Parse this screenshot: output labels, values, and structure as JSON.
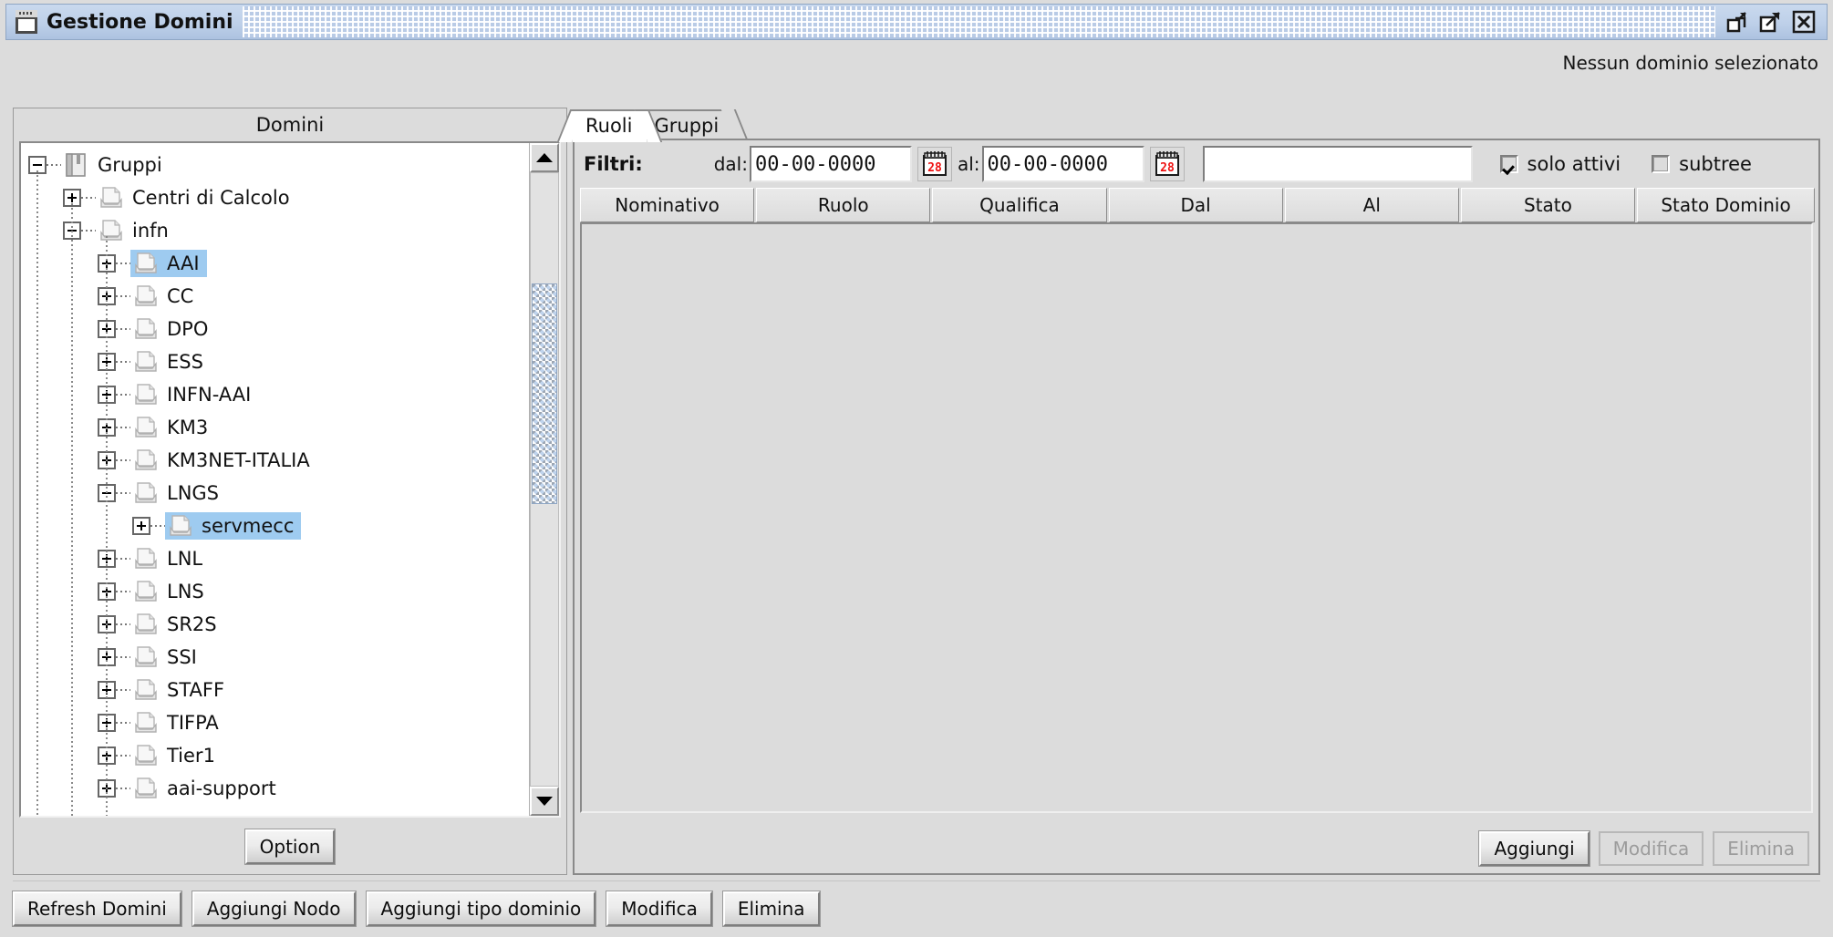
{
  "window": {
    "title": "Gestione Domini",
    "icon": "window-document-icon",
    "controls": [
      {
        "name": "restore-button",
        "label": "restore"
      },
      {
        "name": "maximize-button",
        "label": "maximize"
      },
      {
        "name": "close-button",
        "label": "close"
      }
    ]
  },
  "status": {
    "text": "Nessun dominio selezionato"
  },
  "left_panel": {
    "title": "Domini",
    "option_button": "Option",
    "tree": [
      {
        "label": "Gruppi",
        "depth": 0,
        "expander": "minus",
        "icon": "book-icon",
        "selected": false
      },
      {
        "label": "Centri di Calcolo",
        "depth": 1,
        "expander": "plus",
        "icon": "document-icon",
        "selected": false
      },
      {
        "label": "infn",
        "depth": 1,
        "expander": "minus",
        "icon": "document-icon",
        "selected": false
      },
      {
        "label": "AAI",
        "depth": 2,
        "expander": "plus",
        "icon": "document-icon",
        "selected": true
      },
      {
        "label": "CC",
        "depth": 2,
        "expander": "plus",
        "icon": "document-icon",
        "selected": false
      },
      {
        "label": "DPO",
        "depth": 2,
        "expander": "plus",
        "icon": "document-icon",
        "selected": false
      },
      {
        "label": "ESS",
        "depth": 2,
        "expander": "plus",
        "icon": "document-icon",
        "selected": false
      },
      {
        "label": "INFN-AAI",
        "depth": 2,
        "expander": "plus",
        "icon": "document-icon",
        "selected": false
      },
      {
        "label": "KM3",
        "depth": 2,
        "expander": "plus",
        "icon": "document-icon",
        "selected": false
      },
      {
        "label": "KM3NET-ITALIA",
        "depth": 2,
        "expander": "plus",
        "icon": "document-icon",
        "selected": false
      },
      {
        "label": "LNGS",
        "depth": 2,
        "expander": "minus",
        "icon": "document-icon",
        "selected": false
      },
      {
        "label": "servmecc",
        "depth": 3,
        "expander": "plus",
        "icon": "document-icon",
        "selected": true
      },
      {
        "label": "LNL",
        "depth": 2,
        "expander": "plus",
        "icon": "document-icon",
        "selected": false
      },
      {
        "label": "LNS",
        "depth": 2,
        "expander": "plus",
        "icon": "document-icon",
        "selected": false
      },
      {
        "label": "SR2S",
        "depth": 2,
        "expander": "plus",
        "icon": "document-icon",
        "selected": false
      },
      {
        "label": "SSI",
        "depth": 2,
        "expander": "plus",
        "icon": "document-icon",
        "selected": false
      },
      {
        "label": "STAFF",
        "depth": 2,
        "expander": "plus",
        "icon": "document-icon",
        "selected": false
      },
      {
        "label": "TIFPA",
        "depth": 2,
        "expander": "plus",
        "icon": "document-icon",
        "selected": false
      },
      {
        "label": "Tier1",
        "depth": 2,
        "expander": "plus",
        "icon": "document-icon",
        "selected": false
      },
      {
        "label": "aai-support",
        "depth": 2,
        "expander": "plus",
        "icon": "document-icon",
        "selected": false
      }
    ],
    "scrollbar": {
      "up_arrow": "scroll-up-icon",
      "down_arrow": "scroll-down-icon"
    }
  },
  "right_panel": {
    "tabs": [
      {
        "label": "Ruoli",
        "active": true
      },
      {
        "label": "Gruppi",
        "active": false
      }
    ],
    "filters": {
      "title": "Filtri:",
      "from_label": "dal:",
      "from_value": "00-00-0000",
      "to_label": "al:",
      "to_value": "00-00-0000",
      "calendar_icon_day": "28",
      "search_value": "",
      "search_placeholder": "",
      "checkboxes": [
        {
          "label": "solo attivi",
          "checked": true
        },
        {
          "label": "subtree",
          "checked": false
        }
      ]
    },
    "table": {
      "columns": [
        "Nominativo",
        "Ruolo",
        "Qualifica",
        "Dal",
        "Al",
        "Stato",
        "Stato Dominio"
      ],
      "rows": []
    },
    "buttons": [
      {
        "label": "Aggiungi",
        "enabled": true
      },
      {
        "label": "Modifica",
        "enabled": false
      },
      {
        "label": "Elimina",
        "enabled": false
      }
    ]
  },
  "bottom_toolbar": [
    {
      "label": "Refresh Domini",
      "enabled": true
    },
    {
      "label": "Aggiungi Nodo",
      "enabled": true
    },
    {
      "label": "Aggiungi tipo dominio",
      "enabled": true
    },
    {
      "label": "Modifica",
      "enabled": true
    },
    {
      "label": "Elimina",
      "enabled": true
    }
  ],
  "colors": {
    "selection": "#9ecbf0",
    "titlebar": "#bed0e9",
    "panel": "#dcdcdc",
    "calendar_red": "#ee1111"
  }
}
